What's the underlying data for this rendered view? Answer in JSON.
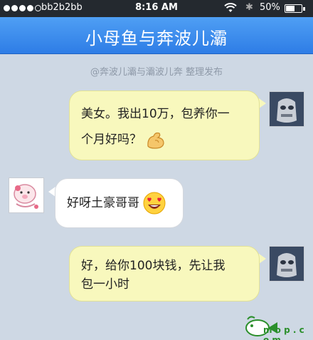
{
  "status_bar": {
    "carrier": "bb2b2bb",
    "time": "8:16 AM",
    "battery_percent": "50%",
    "battery_level": 0.5,
    "signal_bars_filled": 4,
    "signal_bars_total": 5
  },
  "header": {
    "title": "小母鱼与奔波儿灞"
  },
  "credit": "@奔波儿灞与灞波儿奔 整理发布",
  "messages": [
    {
      "side": "right",
      "lines": [
        "美女。我出10万，包养你一",
        "个月好吗？"
      ],
      "emoji": "muscle-arm-icon",
      "avatar": "robot-avatar"
    },
    {
      "side": "left",
      "lines": [
        "好呀土豪哥哥"
      ],
      "emoji": "heart-eyes-emoji",
      "avatar": "pig-avatar"
    },
    {
      "side": "right",
      "lines": [
        "好，给你100块钱，先让我",
        "包一小时"
      ],
      "avatar": "robot-avatar"
    }
  ],
  "watermark": {
    "text": "m o p . c o m",
    "logo": "fish-logo-icon"
  },
  "colors": {
    "title_bar": "#3a8cf0",
    "background": "#ced8e4",
    "right_bubble": "#f8f8bd",
    "left_bubble": "#ffffff"
  }
}
